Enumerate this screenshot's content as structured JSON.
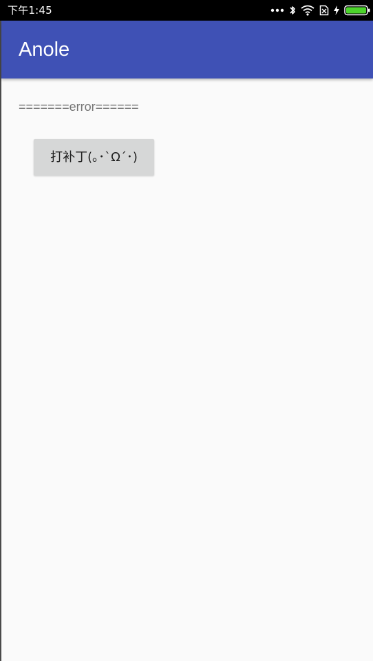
{
  "status_bar": {
    "time": "下午1:45",
    "icons": [
      "more-dots-icon",
      "bluetooth-icon",
      "wifi-icon",
      "no-sim-icon",
      "charging-icon",
      "battery-icon"
    ],
    "battery_color": "#4cd42b"
  },
  "app_bar": {
    "title": "Anole",
    "color": "#3f51b5"
  },
  "main": {
    "error_text": "=======error======",
    "patch_button_label": "打补丁(｡･`Ω´･)"
  }
}
